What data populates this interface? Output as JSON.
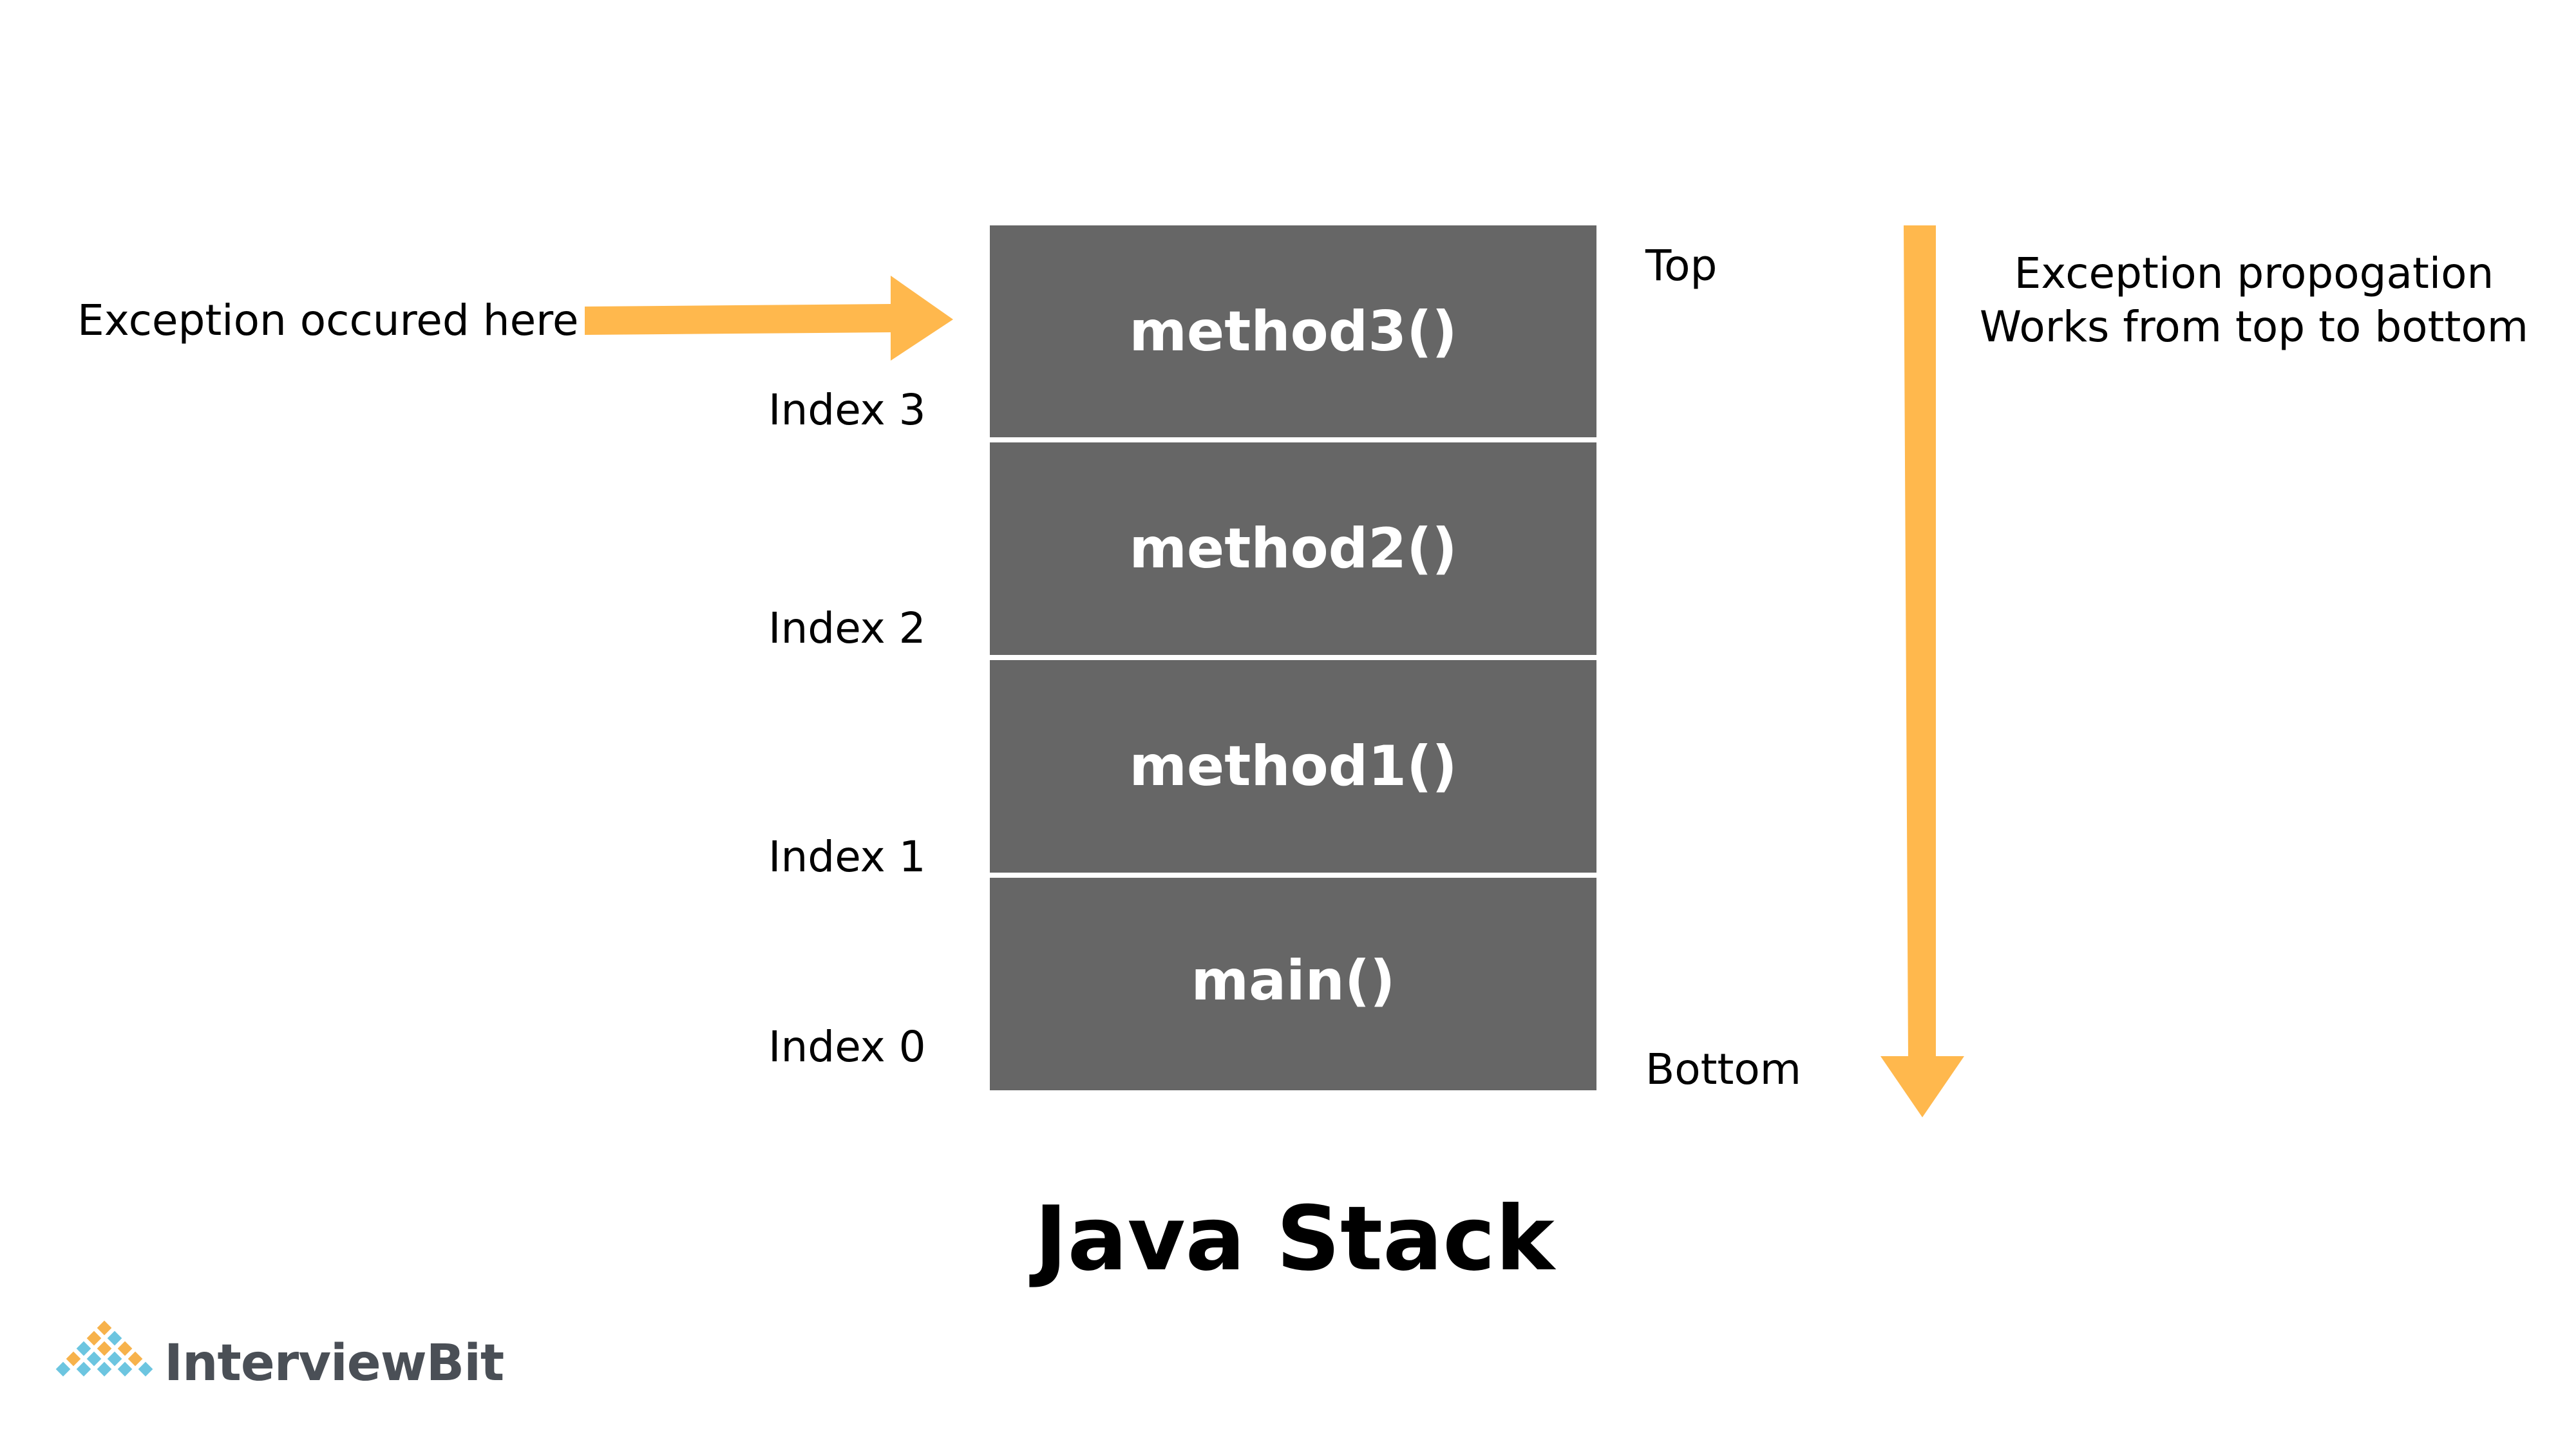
{
  "annotation": {
    "exception_label": "Exception occured here",
    "top_label": "Top",
    "bottom_label": "Bottom",
    "propagation_line1": "Exception propogation",
    "propagation_line2": "Works from top to bottom"
  },
  "stack": {
    "frames": [
      {
        "label": "method3()",
        "index_label": "Index 3"
      },
      {
        "label": "method2()",
        "index_label": "Index 2"
      },
      {
        "label": "method1()",
        "index_label": "Index 1"
      },
      {
        "label": "main()",
        "index_label": "Index 0"
      }
    ]
  },
  "title": "Java Stack",
  "brand": {
    "name": "InterviewBit",
    "logo_icon": "interviewbit-logo-icon"
  },
  "colors": {
    "arrow": "#FFB84D",
    "block": "#666666",
    "block_text": "#FFFFFF",
    "brand_blue": "#6CC5E0",
    "brand_orange": "#F7B24B"
  }
}
